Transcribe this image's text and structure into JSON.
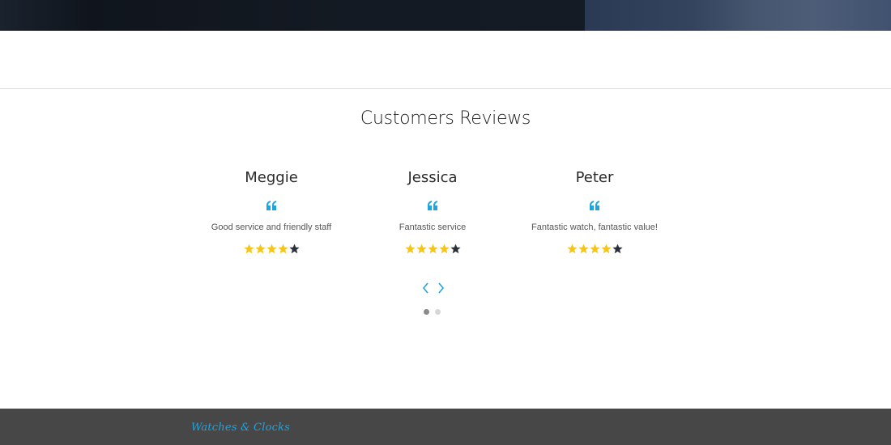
{
  "section": {
    "title": "Customers Reviews"
  },
  "reviews": [
    {
      "name": "Meggie",
      "text": "Good service and friendly staff",
      "rating": 4,
      "max_rating": 5
    },
    {
      "name": "Jessica",
      "text": "Fantastic service",
      "rating": 4,
      "max_rating": 5
    },
    {
      "name": "Peter",
      "text": "Fantastic watch, fantastic value!",
      "rating": 4,
      "max_rating": 5
    }
  ],
  "carousel": {
    "active_page": 1,
    "page_count": 2,
    "prev_icon": "chevron-left-icon",
    "next_icon": "chevron-right-icon"
  },
  "footer": {
    "brand": "Watches & Clocks"
  },
  "colors": {
    "accent": "#1fa4e0",
    "star_filled": "#f5c518",
    "star_empty": "#2b2f3a",
    "footer_bg": "#474747"
  }
}
